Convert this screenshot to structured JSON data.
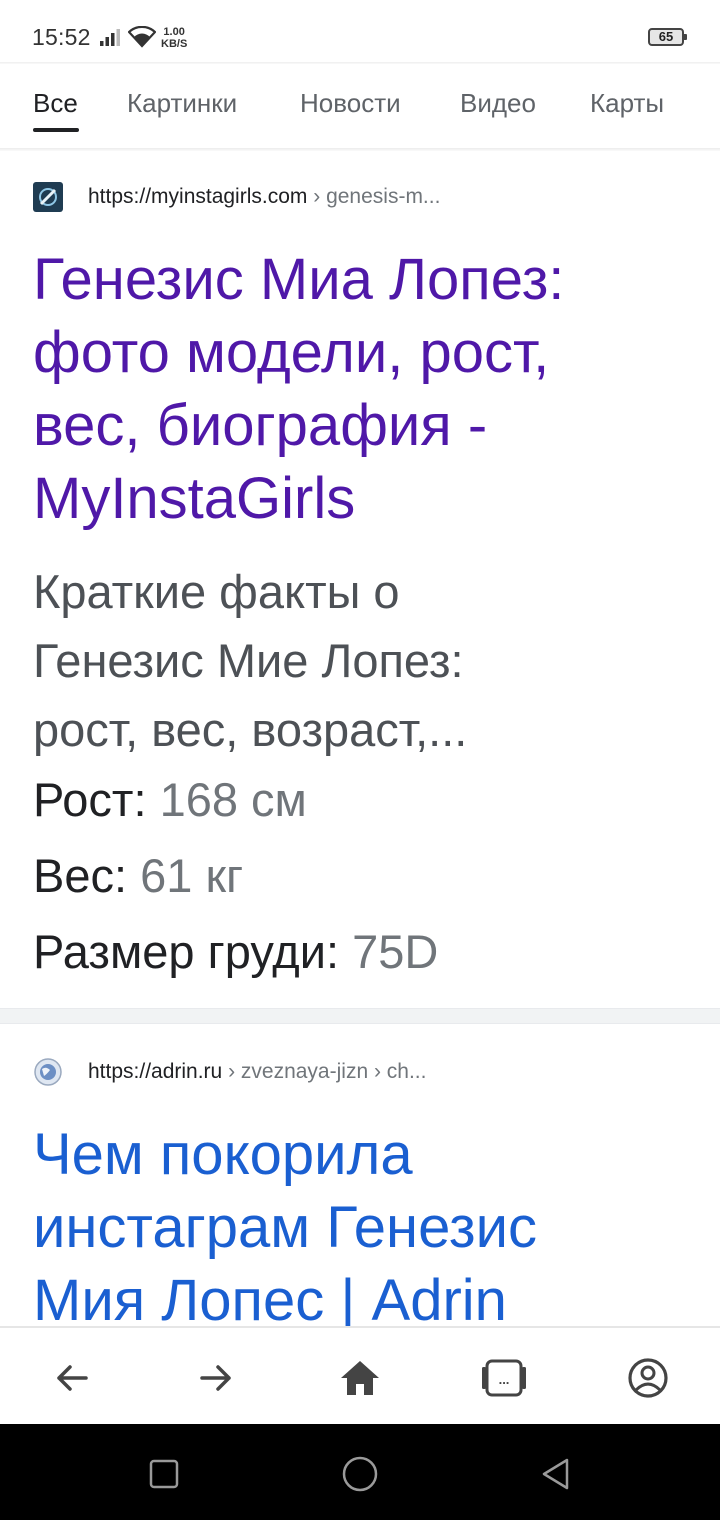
{
  "status_bar": {
    "time": "15:52",
    "net_speed_value": "1.00",
    "net_speed_unit": "KB/S",
    "battery": "65"
  },
  "tabs": [
    {
      "label": "Все",
      "active": true
    },
    {
      "label": "Картинки",
      "active": false
    },
    {
      "label": "Новости",
      "active": false
    },
    {
      "label": "Видео",
      "active": false
    },
    {
      "label": "Карты",
      "active": false
    }
  ],
  "results": [
    {
      "favicon": "myinstagirls-favicon",
      "url_domain": "https://myinstagirls.com",
      "url_path": " › genesis-m...",
      "title_lines": [
        "Генезис Миа Лопез:",
        "фото модели, рост,",
        "вес, биография -",
        "MyInstaGirls"
      ],
      "snippet_lines": [
        "Краткие факты о",
        "Генезис Мие Лопез:",
        "рост, вес, возраст,..."
      ],
      "facts": [
        {
          "label": "Рост: ",
          "value": "168 см"
        },
        {
          "label": "Вес: ",
          "value": "61 кг"
        },
        {
          "label": "Размер груди: ",
          "value": "75D"
        }
      ]
    },
    {
      "favicon": "globe-icon",
      "url_domain": "https://adrin.ru",
      "url_path": " › zveznaya-jizn › ch...",
      "title_lines": [
        "Чем покорила",
        "инстаграм Генезис",
        "Мия Лопес | Adrin"
      ]
    }
  ],
  "toolbar": {
    "icons": [
      "back-arrow-icon",
      "forward-arrow-icon",
      "home-icon",
      "tabs-icon",
      "account-icon"
    ],
    "tabs_label": "..."
  },
  "android_nav": {
    "icons": [
      "recents-square-icon",
      "home-circle-icon",
      "back-triangle-icon"
    ]
  },
  "colors": {
    "visited_title": "#4f18a8",
    "link_title": "#1a5fd1",
    "snippet": "#4d5156",
    "url_crumbs": "#70757a"
  }
}
